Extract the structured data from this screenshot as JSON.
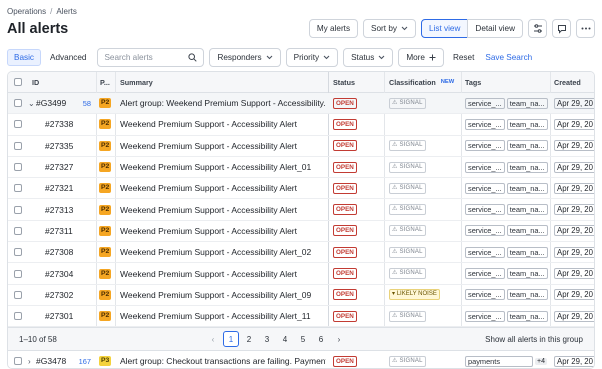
{
  "breadcrumb": [
    "Operations",
    "Alerts"
  ],
  "title": "All alerts",
  "toolbar": {
    "my_alerts": "My alerts",
    "sort_by": "Sort by",
    "list_view": "List view",
    "detail_view": "Detail view"
  },
  "filters": {
    "tab_basic": "Basic",
    "tab_advanced": "Advanced",
    "search_placeholder": "Search alerts",
    "responders": "Responders",
    "priority": "Priority",
    "status": "Status",
    "more": "More",
    "reset": "Reset",
    "save_search": "Save Search"
  },
  "columns": {
    "id": "ID",
    "priority": "P...",
    "summary": "Summary",
    "status": "Status",
    "classification": "Classification",
    "new_badge": "NEW",
    "tags": "Tags",
    "created": "Created"
  },
  "group1": {
    "id": "#G3499",
    "count": "58",
    "priority": "P2",
    "summary": "Alert group: Weekend Premium Support - Accessibility...",
    "status": "OPEN",
    "classification": "SIGNAL",
    "tags": [
      "service_...",
      "team_na..."
    ],
    "created": "Apr 29, 20"
  },
  "rows": [
    {
      "id": "#27338",
      "priority": "P2",
      "summary": "Weekend Premium Support - Accessibility Alert",
      "status": "OPEN",
      "classification": "",
      "tags": [
        "service_...",
        "team_na..."
      ],
      "created": "Apr 29, 20"
    },
    {
      "id": "#27335",
      "priority": "P2",
      "summary": "Weekend Premium Support - Accessibility Alert",
      "status": "OPEN",
      "classification": "SIGNAL",
      "tags": [
        "service_...",
        "team_na..."
      ],
      "created": "Apr 29, 20"
    },
    {
      "id": "#27327",
      "priority": "P2",
      "summary": "Weekend Premium Support - Accessibility Alert_01",
      "status": "OPEN",
      "classification": "SIGNAL",
      "tags": [
        "service_...",
        "team_na..."
      ],
      "created": "Apr 29, 20"
    },
    {
      "id": "#27321",
      "priority": "P2",
      "summary": "Weekend Premium Support - Accessibility Alert",
      "status": "OPEN",
      "classification": "SIGNAL",
      "tags": [
        "service_...",
        "team_na..."
      ],
      "created": "Apr 29, 20"
    },
    {
      "id": "#27313",
      "priority": "P2",
      "summary": "Weekend Premium Support - Accessibility Alert",
      "status": "OPEN",
      "classification": "SIGNAL",
      "tags": [
        "service_...",
        "team_na..."
      ],
      "created": "Apr 29, 20"
    },
    {
      "id": "#27311",
      "priority": "P2",
      "summary": "Weekend Premium Support - Accessibility Alert",
      "status": "OPEN",
      "classification": "SIGNAL",
      "tags": [
        "service_...",
        "team_na..."
      ],
      "created": "Apr 29, 20"
    },
    {
      "id": "#27308",
      "priority": "P2",
      "summary": "Weekend Premium Support - Accessibility Alert_02",
      "status": "OPEN",
      "classification": "SIGNAL",
      "tags": [
        "service_...",
        "team_na..."
      ],
      "created": "Apr 29, 20"
    },
    {
      "id": "#27304",
      "priority": "P2",
      "summary": "Weekend Premium Support - Accessibility Alert",
      "status": "OPEN",
      "classification": "SIGNAL",
      "tags": [
        "service_...",
        "team_na..."
      ],
      "created": "Apr 29, 20"
    },
    {
      "id": "#27302",
      "priority": "P2",
      "summary": "Weekend Premium Support - Accessibility Alert_09",
      "status": "OPEN",
      "classification": "LIKELY NOISE",
      "tags": [
        "service_...",
        "team_na..."
      ],
      "created": "Apr 29, 20"
    },
    {
      "id": "#27301",
      "priority": "P2",
      "summary": "Weekend Premium Support - Accessibility Alert_11",
      "status": "OPEN",
      "classification": "SIGNAL",
      "tags": [
        "service_...",
        "team_na..."
      ],
      "created": "Apr 29, 20"
    }
  ],
  "pagination": {
    "range": "1–10 of 58",
    "pages": [
      "1",
      "2",
      "3",
      "4",
      "5",
      "6"
    ],
    "show_all": "Show all alerts in this group"
  },
  "group2": {
    "id": "#G3478",
    "count": "167",
    "priority": "P3",
    "summary": "Alert group: Checkout transactions are failing. Payment-...",
    "status": "OPEN",
    "classification": "SIGNAL",
    "tag": "payments",
    "tag_more": "+4",
    "created": "Apr 29, 20"
  },
  "colors": {
    "accent": "#2e6be6",
    "open_status": "#c23b33",
    "p2": "#f5a623",
    "p3": "#f4d23c"
  }
}
